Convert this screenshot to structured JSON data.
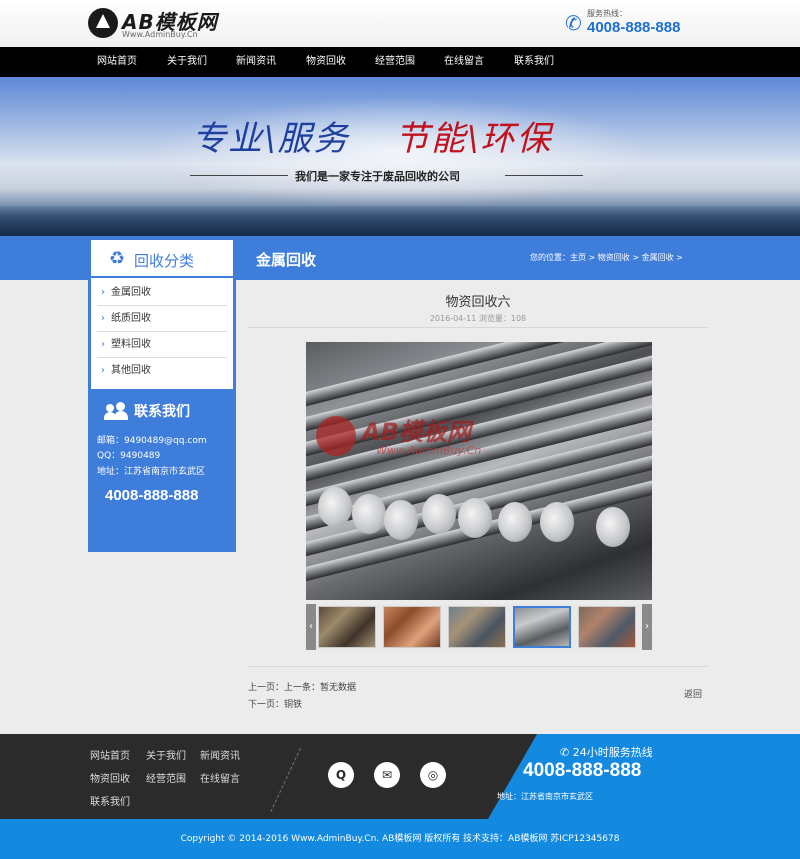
{
  "header": {
    "logo_text": "AB模板网",
    "logo_sub": "Www.AdminBuy.Cn",
    "hotline_label": "服务热线：",
    "hotline_number": "4008-888-888"
  },
  "nav": {
    "items": [
      "网站首页",
      "关于我们",
      "新闻资讯",
      "物资回收",
      "经营范围",
      "在线留言",
      "联系我们"
    ]
  },
  "banner": {
    "slogan_1": "专业\\服务",
    "slogan_2": "节能\\环保",
    "subtitle": "我们是一家专注于废品回收的公司"
  },
  "section": {
    "title": "金属回收",
    "breadcrumb": "您的位置：主页 > 物资回收 > 金属回收 >"
  },
  "sidebar": {
    "category_title": "回收分类",
    "categories": [
      "金属回收",
      "纸质回收",
      "塑料回收",
      "其他回收"
    ],
    "contact_title": "联系我们",
    "email": "邮箱：9490489@qq.com",
    "qq": "QQ：9490489",
    "address": "地址：江苏省南京市玄武区",
    "phone": "4008-888-888"
  },
  "article": {
    "title": "物资回收六",
    "meta": "2016-04-11  浏览量：108",
    "watermark_text": "AB模板网",
    "watermark_sub": "Www.AdminBuy.Cn",
    "prev": "上一页：上一条：暂无数据",
    "next": "下一页：铜铁",
    "back": "返回"
  },
  "footer": {
    "links": [
      "网站首页",
      "关于我们",
      "新闻资讯",
      "物资回收",
      "经营范围",
      "在线留言",
      "联系我们"
    ],
    "hotline_label": "24小时服务热线",
    "hotline_number": "4008-888-888",
    "address": "地址：江苏省南京市玄武区",
    "copyright": "Copyright © 2014-2016 Www.AdminBuy.Cn. AB模板网 版权所有    技术支持：AB模板网    苏ICP12345678"
  },
  "colors": {
    "accent": "#3f7ddb",
    "footer_blue": "#1389e0",
    "nav_bg": "#000000",
    "footer_bg": "#2b2b2b"
  },
  "icons": [
    "phone-icon",
    "recycle-icon",
    "contacts-icon",
    "arrow-right-icon",
    "qq-icon",
    "wechat-icon",
    "weibo-icon",
    "chevron-left-icon",
    "chevron-right-icon"
  ]
}
